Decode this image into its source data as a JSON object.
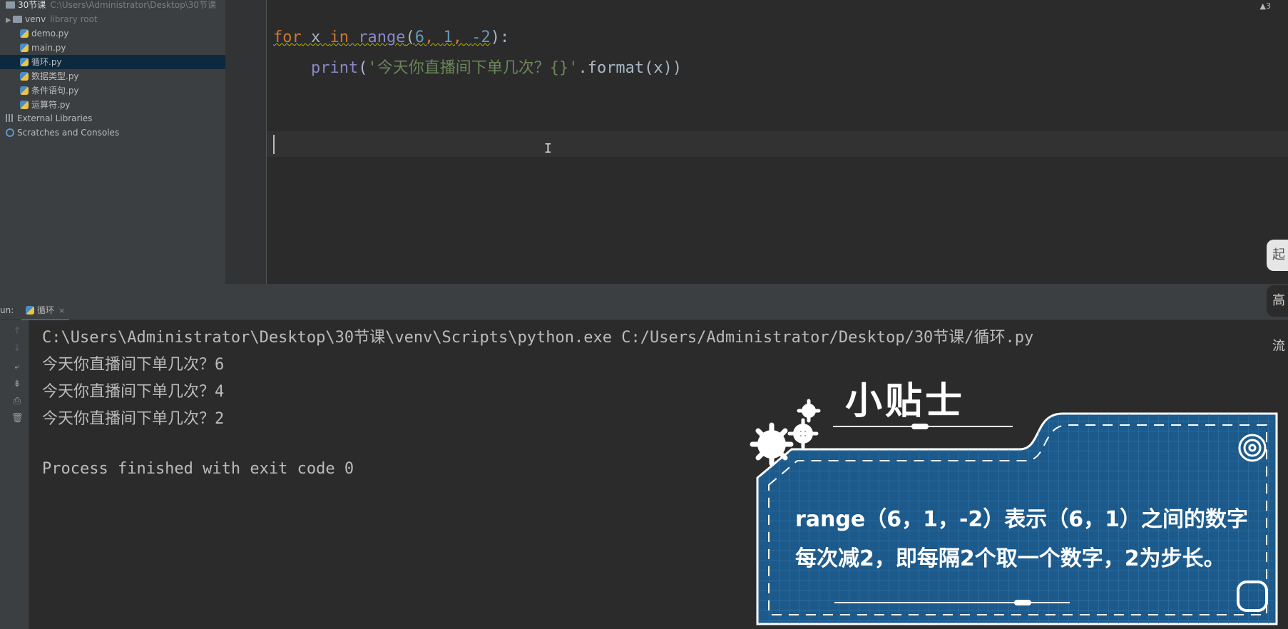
{
  "project": {
    "root": {
      "name": "30节课",
      "path": "C:\\Users\\Administrator\\Desktop\\30节课"
    },
    "venv": {
      "name": "venv",
      "hint": "library root"
    },
    "files": [
      {
        "name": "demo.py",
        "selected": false
      },
      {
        "name": "main.py",
        "selected": false
      },
      {
        "name": "循环.py",
        "selected": true
      },
      {
        "name": "数据类型.py",
        "selected": false
      },
      {
        "name": "条件语句.py",
        "selected": false
      },
      {
        "name": "运算符.py",
        "selected": false
      }
    ],
    "external": "External Libraries",
    "scratches": "Scratches and Consoles"
  },
  "editor": {
    "warning_count": "▲3",
    "line1": {
      "kw_for": "for",
      "var": " x ",
      "kw_in": "in",
      "fn": " range",
      "open": "(",
      "a": "6",
      "c1": ", ",
      "b": "1",
      "c2": ", ",
      "c": "-2",
      "close": "):"
    },
    "line2": {
      "indent": "    ",
      "fn": "print",
      "open": "(",
      "str": "'今天你直播间下单几次？{}'",
      "rest": ".format(x))"
    }
  },
  "run": {
    "label": "un:",
    "tab": "循环",
    "close": "×",
    "console": [
      "C:\\Users\\Administrator\\Desktop\\30节课\\venv\\Scripts\\python.exe C:/Users/Administrator/Desktop/30节课/循环.py",
      "今天你直播间下单几次？6",
      "今天你直播间下单几次？4",
      "今天你直播间下单几次？2",
      "",
      "Process finished with exit code 0"
    ]
  },
  "side_buttons": [
    "起",
    "高",
    "流"
  ],
  "tip": {
    "title": "小贴士",
    "line1": "range（6，1，-2）表示（6，1）之间的数字",
    "line2": "每次减2，即每隔2个取一个数字，2为步长。",
    "panel_color": "#1d5a8c",
    "border_color": "#ffffff"
  }
}
